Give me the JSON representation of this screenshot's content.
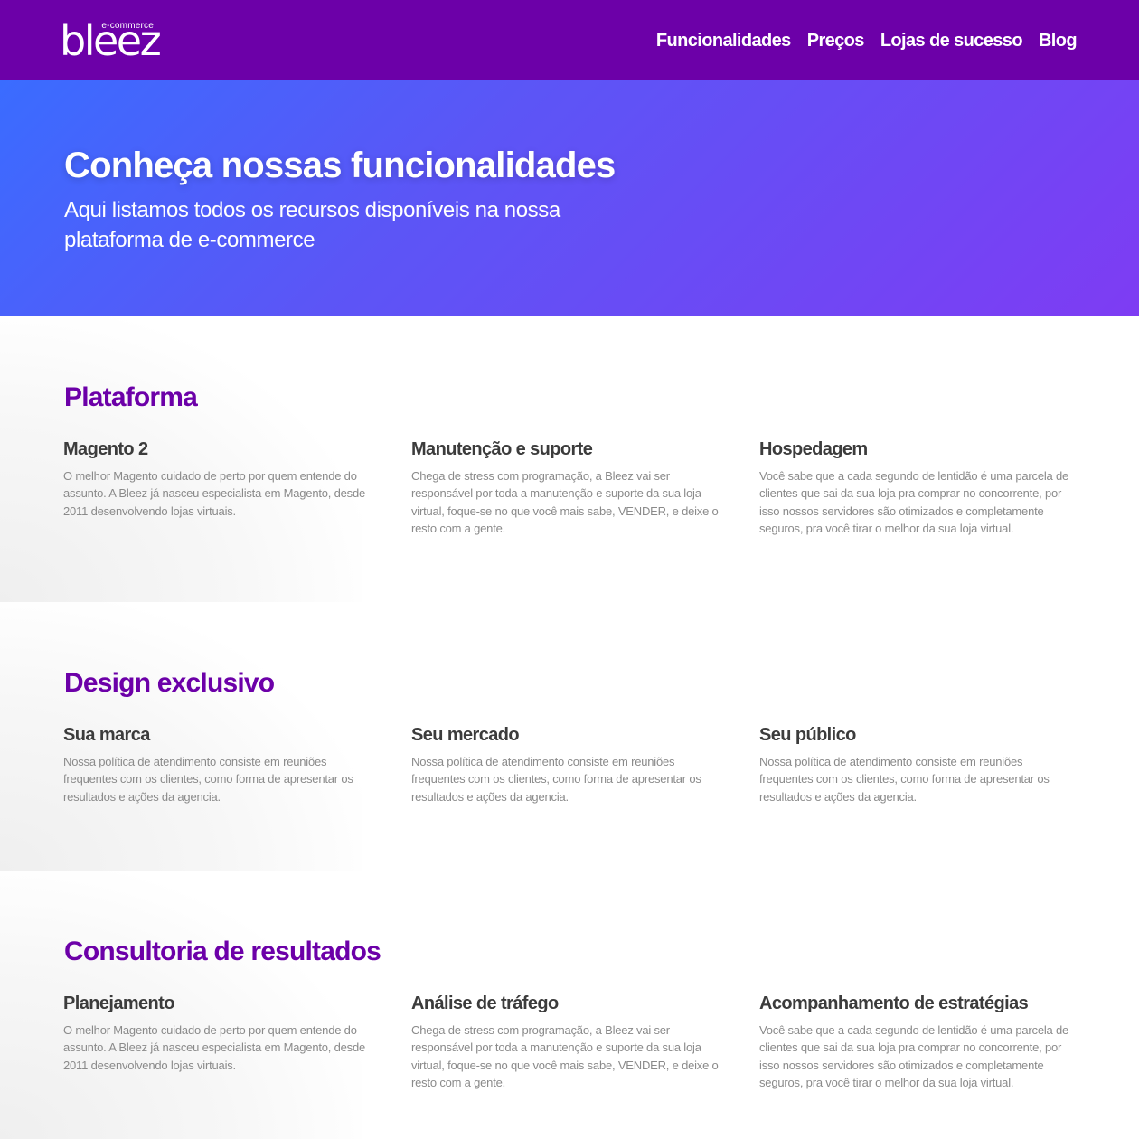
{
  "header": {
    "logo": {
      "main": "bleez",
      "sub": "e-commerce"
    },
    "nav": [
      "Funcionalidades",
      "Preços",
      "Lojas de sucesso",
      "Blog"
    ],
    "background_color": "#6c00a8"
  },
  "hero": {
    "title": "Conheça nossas funcionalidades",
    "subtitle": "Aqui listamos todos os recursos disponíveis na nossa plataforma de e-commerce",
    "gradient": [
      "#3a6cff",
      "#7e3cf3"
    ]
  },
  "accent_color": "#6c00a8",
  "sections": [
    {
      "title": "Plataforma",
      "features": [
        {
          "title": "Magento 2",
          "text": "O melhor Magento cuidado de perto por quem entende do assunto. A Bleez já nasceu especialista em Magento, desde 2011 desenvolvendo lojas virtuais."
        },
        {
          "title": "Manutenção e suporte",
          "text": "Chega de stress com programação, a Bleez vai ser responsável por toda a manutenção e suporte da sua loja virtual, foque-se no que você mais sabe, VENDER, e deixe o resto com a gente."
        },
        {
          "title": "Hospedagem",
          "text": "Você sabe que a cada segundo de lentidão é uma parcela de clientes que sai da sua loja pra comprar no concorrente, por isso nossos servidores são otimizados e completamente seguros, pra você tirar o melhor da sua loja virtual."
        }
      ]
    },
    {
      "title": "Design exclusivo",
      "features": [
        {
          "title": "Sua marca",
          "text": "Nossa política de atendimento consiste em reuniões frequentes com os clientes, como forma de apresentar os resultados e ações da agencia."
        },
        {
          "title": "Seu mercado",
          "text": "Nossa política de atendimento consiste em reuniões frequentes com os clientes, como forma de apresentar os resultados e ações da agencia."
        },
        {
          "title": "Seu público",
          "text": "Nossa política de atendimento consiste em reuniões frequentes com os clientes, como forma de apresentar os resultados e ações da agencia."
        }
      ]
    },
    {
      "title": "Consultoria de resultados",
      "features": [
        {
          "title": "Planejamento",
          "text": "O melhor Magento cuidado de perto por quem entende do assunto. A Bleez já nasceu especialista em Magento, desde 2011 desenvolvendo lojas virtuais."
        },
        {
          "title": "Análise de tráfego",
          "text": "Chega de stress com programação, a Bleez vai ser responsável por toda a manutenção e suporte da sua loja virtual, foque-se no que você mais sabe, VENDER, e deixe o resto com a gente."
        },
        {
          "title": "Acompanhamento de estratégias",
          "text": "Você sabe que a cada segundo de lentidão é uma parcela de clientes que sai da sua loja pra comprar no concorrente, por isso nossos servidores são otimizados e completamente seguros, pra você tirar o melhor da sua loja virtual."
        }
      ]
    }
  ]
}
